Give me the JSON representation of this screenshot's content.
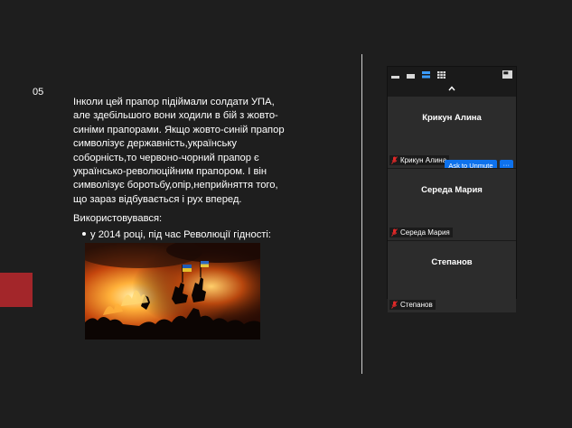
{
  "slide": {
    "number": "05",
    "paragraph_lines": [
      "Інколи цей прапор підіймали солдати УПА,",
      "але здебільшого вони ходили в бій з жовто-",
      "синіми прапорами. Якщо жовто-синій прапор",
      "символізує державність,українську",
      "соборність,то червоно-чорний прапор є",
      "українсько-революційним прапором. І він",
      "символізує боротьбу,опір,неприйняття того,",
      "що зараз відбувається і рух вперед."
    ],
    "used_label": "Використовувався:",
    "bullet": "у 2014 році, під час Революції гідності:",
    "accent_color": "#a3262a"
  },
  "gallery": {
    "toolbar_icons": [
      "speaker-view-icon",
      "minimize-view-icon",
      "strip-view-icon",
      "grid-view-icon",
      "popout-icon"
    ],
    "collapse_icon": "chevron-up-icon",
    "participants": [
      {
        "display_name": "Крикун Алина",
        "tag": "Крикун Алина",
        "muted": true
      },
      {
        "display_name": "Середа Мария",
        "tag": "Середа Мария",
        "muted": true
      },
      {
        "display_name": "Степанов",
        "tag": "Степанов",
        "muted": true
      }
    ],
    "unmute_label": "Ask to Unmute",
    "more_label": "···",
    "accent_color": "#0e72ed",
    "muted_color": "#e02828"
  }
}
